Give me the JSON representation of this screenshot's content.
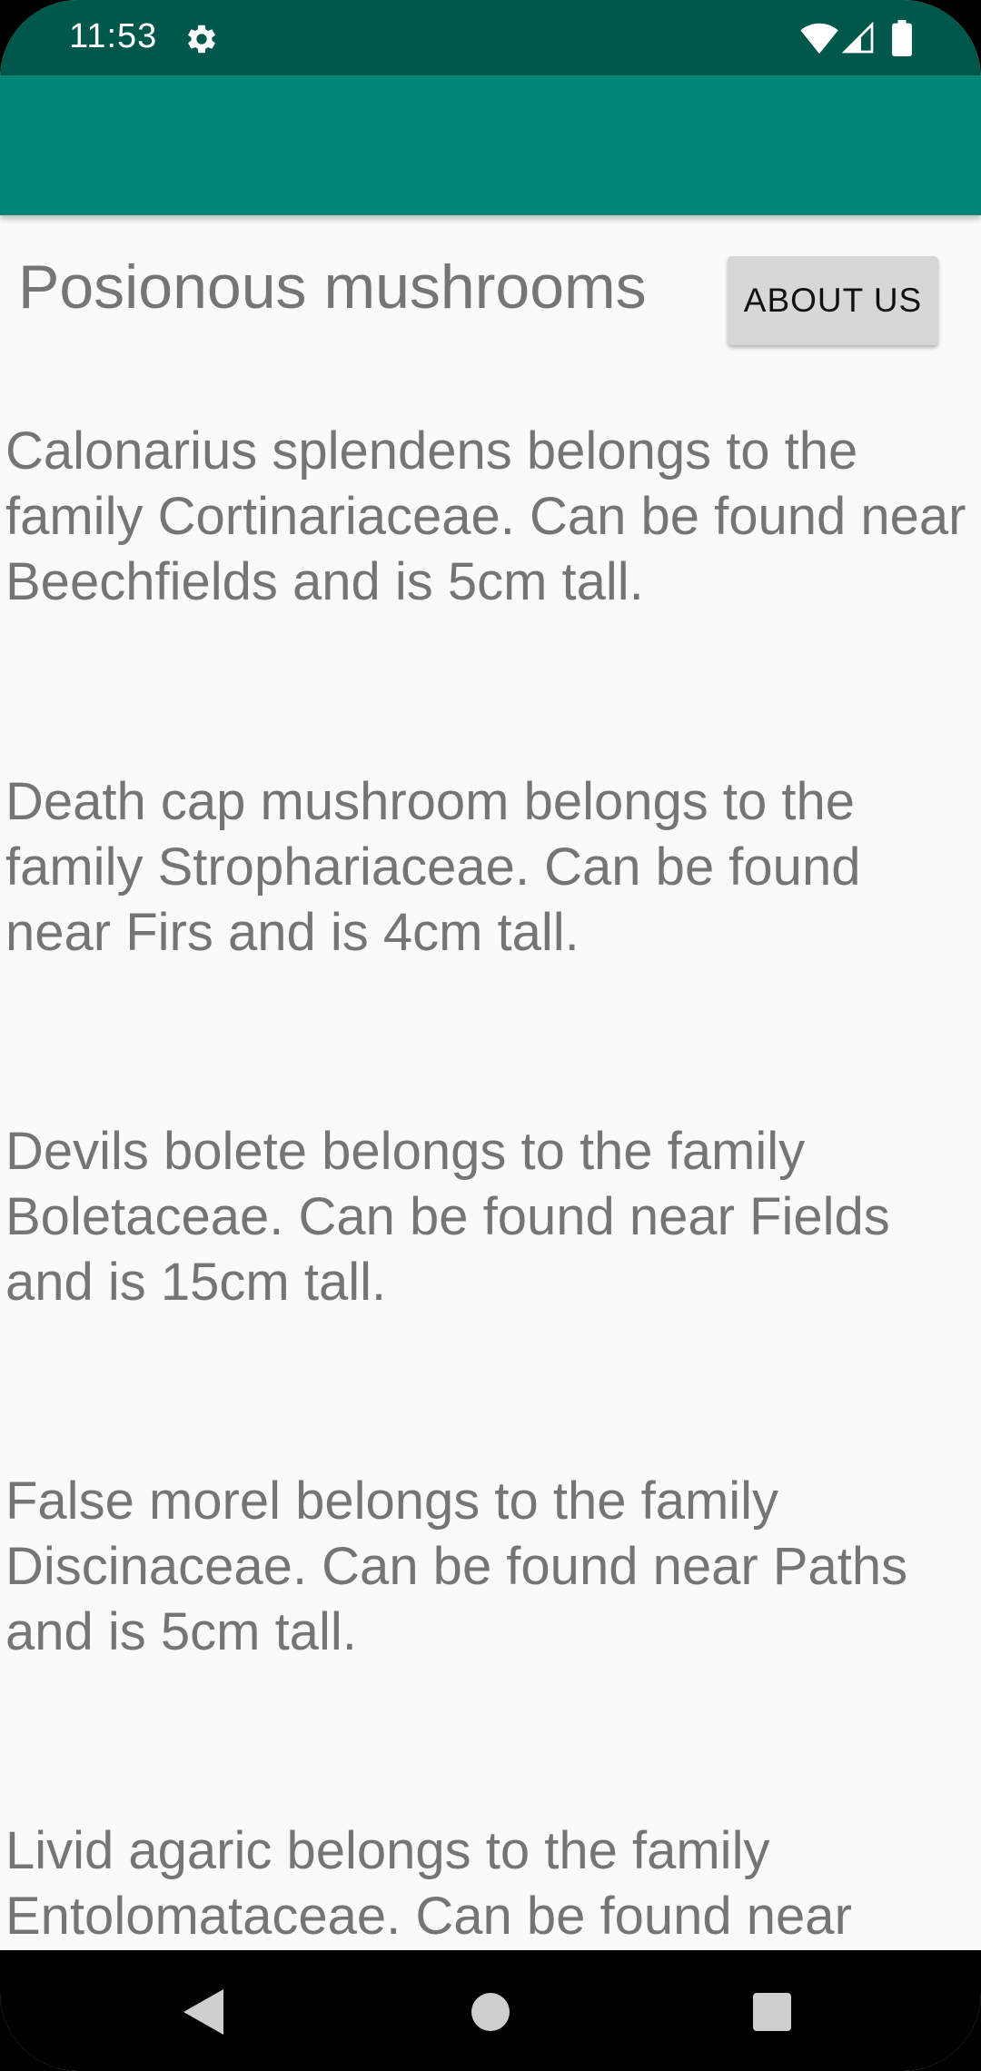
{
  "status_bar": {
    "time": "11:53",
    "icons": [
      "gear-icon",
      "wifi-icon",
      "cell-signal-icon",
      "battery-icon"
    ]
  },
  "app_bar": {
    "color": "#008577"
  },
  "page": {
    "title": "Posionous mushrooms",
    "about_button_label": "ABOUT US"
  },
  "mushrooms": [
    {
      "description": "Calonarius splendens belongs to the family Cortinariaceae. Can be found near Beechfields and is 5cm tall."
    },
    {
      "description": "Death cap mushroom belongs to the family Strophariaceae. Can be found near Firs and is 4cm tall."
    },
    {
      "description": "Devils bolete belongs to the family Boletaceae. Can be found near Fields and is 15cm tall."
    },
    {
      "description": "False morel belongs to the family Discinaceae. Can be found near Paths and is 5cm tall."
    },
    {
      "description": "Livid agaric belongs to the family Entolomataceae. Can be found near"
    }
  ],
  "nav_bar": {
    "icons": [
      "back-icon",
      "home-icon",
      "recents-icon"
    ]
  },
  "colors": {
    "status_bar": "#00574b",
    "app_bar": "#008577",
    "background": "#fafafa",
    "text": "#757575",
    "button": "#d6d7d7"
  }
}
